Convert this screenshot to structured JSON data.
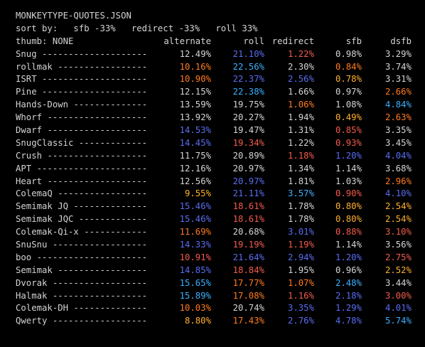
{
  "title": "MONKEYTYPE-QUOTES.JSON",
  "sort_line": "sort by:   sfb -33%   redirect -33%   roll 33%",
  "header": {
    "thumb": "thumb: NONE",
    "columns": [
      "alternate",
      "roll",
      "redirect",
      "sfb",
      "dsfb"
    ]
  },
  "colors": {
    "default": "#d4d4d4",
    "orange": "#ff7a1f",
    "red": "#f25b4d",
    "blue": "#5a6cf0",
    "cyan": "#3ab0ff",
    "gold": "#ffb02e"
  },
  "rows": [
    {
      "name": "Snug",
      "dashes": "--------------------",
      "cells": [
        {
          "v": "12.49%",
          "c": "default"
        },
        {
          "v": "21.10%",
          "c": "blue"
        },
        {
          "v": "1.22%",
          "c": "red"
        },
        {
          "v": "0.98%",
          "c": "default"
        },
        {
          "v": "3.29%",
          "c": "default"
        }
      ]
    },
    {
      "name": "rollmak",
      "dashes": "-----------------",
      "cells": [
        {
          "v": "10.16%",
          "c": "orange"
        },
        {
          "v": "22.56%",
          "c": "cyan"
        },
        {
          "v": "2.30%",
          "c": "default"
        },
        {
          "v": "0.84%",
          "c": "orange"
        },
        {
          "v": "3.74%",
          "c": "default"
        }
      ]
    },
    {
      "name": "ISRT",
      "dashes": "--------------------",
      "cells": [
        {
          "v": "10.90%",
          "c": "orange"
        },
        {
          "v": "22.37%",
          "c": "blue"
        },
        {
          "v": "2.56%",
          "c": "blue"
        },
        {
          "v": "0.78%",
          "c": "gold"
        },
        {
          "v": "3.31%",
          "c": "default"
        }
      ]
    },
    {
      "name": "Pine",
      "dashes": "--------------------",
      "cells": [
        {
          "v": "12.15%",
          "c": "default"
        },
        {
          "v": "22.38%",
          "c": "cyan"
        },
        {
          "v": "1.66%",
          "c": "default"
        },
        {
          "v": "0.97%",
          "c": "default"
        },
        {
          "v": "2.66%",
          "c": "orange"
        }
      ]
    },
    {
      "name": "Hands-Down",
      "dashes": "--------------",
      "cells": [
        {
          "v": "13.59%",
          "c": "default"
        },
        {
          "v": "19.75%",
          "c": "default"
        },
        {
          "v": "1.06%",
          "c": "orange"
        },
        {
          "v": "1.08%",
          "c": "default"
        },
        {
          "v": "4.84%",
          "c": "cyan"
        }
      ]
    },
    {
      "name": "Whorf",
      "dashes": "-------------------",
      "cells": [
        {
          "v": "13.92%",
          "c": "default"
        },
        {
          "v": "20.27%",
          "c": "default"
        },
        {
          "v": "1.94%",
          "c": "default"
        },
        {
          "v": "0.49%",
          "c": "gold"
        },
        {
          "v": "2.63%",
          "c": "orange"
        }
      ]
    },
    {
      "name": "Dwarf",
      "dashes": "-------------------",
      "cells": [
        {
          "v": "14.53%",
          "c": "blue"
        },
        {
          "v": "19.47%",
          "c": "default"
        },
        {
          "v": "1.31%",
          "c": "default"
        },
        {
          "v": "0.85%",
          "c": "red"
        },
        {
          "v": "3.35%",
          "c": "default"
        }
      ]
    },
    {
      "name": "SnugClassic",
      "dashes": "-------------",
      "cells": [
        {
          "v": "14.45%",
          "c": "blue"
        },
        {
          "v": "19.34%",
          "c": "red"
        },
        {
          "v": "1.22%",
          "c": "default"
        },
        {
          "v": "0.93%",
          "c": "red"
        },
        {
          "v": "3.45%",
          "c": "default"
        }
      ]
    },
    {
      "name": "Crush",
      "dashes": "-------------------",
      "cells": [
        {
          "v": "11.75%",
          "c": "default"
        },
        {
          "v": "20.89%",
          "c": "default"
        },
        {
          "v": "1.18%",
          "c": "red"
        },
        {
          "v": "1.20%",
          "c": "blue"
        },
        {
          "v": "4.04%",
          "c": "blue"
        }
      ]
    },
    {
      "name": "APT",
      "dashes": "---------------------",
      "cells": [
        {
          "v": "12.16%",
          "c": "default"
        },
        {
          "v": "20.97%",
          "c": "default"
        },
        {
          "v": "1.34%",
          "c": "default"
        },
        {
          "v": "1.14%",
          "c": "default"
        },
        {
          "v": "3.68%",
          "c": "default"
        }
      ]
    },
    {
      "name": "Heart",
      "dashes": "-------------------",
      "cells": [
        {
          "v": "12.56%",
          "c": "default"
        },
        {
          "v": "20.97%",
          "c": "blue"
        },
        {
          "v": "1.81%",
          "c": "default"
        },
        {
          "v": "1.03%",
          "c": "default"
        },
        {
          "v": "2.96%",
          "c": "orange"
        }
      ]
    },
    {
      "name": "ColemaQ",
      "dashes": "-----------------",
      "cells": [
        {
          "v": "9.55%",
          "c": "gold"
        },
        {
          "v": "21.11%",
          "c": "blue"
        },
        {
          "v": "3.57%",
          "c": "cyan"
        },
        {
          "v": "0.90%",
          "c": "red"
        },
        {
          "v": "4.10%",
          "c": "blue"
        }
      ]
    },
    {
      "name": "Semimak JQ",
      "dashes": "--------------",
      "cells": [
        {
          "v": "15.46%",
          "c": "blue"
        },
        {
          "v": "18.61%",
          "c": "red"
        },
        {
          "v": "1.78%",
          "c": "default"
        },
        {
          "v": "0.80%",
          "c": "gold"
        },
        {
          "v": "2.54%",
          "c": "gold"
        }
      ]
    },
    {
      "name": "Semimak JQC",
      "dashes": "-------------",
      "cells": [
        {
          "v": "15.46%",
          "c": "blue"
        },
        {
          "v": "18.61%",
          "c": "red"
        },
        {
          "v": "1.78%",
          "c": "default"
        },
        {
          "v": "0.80%",
          "c": "gold"
        },
        {
          "v": "2.54%",
          "c": "gold"
        }
      ]
    },
    {
      "name": "Colemak-Qi-x",
      "dashes": "------------",
      "cells": [
        {
          "v": "11.69%",
          "c": "orange"
        },
        {
          "v": "20.68%",
          "c": "default"
        },
        {
          "v": "3.01%",
          "c": "blue"
        },
        {
          "v": "0.88%",
          "c": "red"
        },
        {
          "v": "3.10%",
          "c": "red"
        }
      ]
    },
    {
      "name": "SnuSnu",
      "dashes": "------------------",
      "cells": [
        {
          "v": "14.33%",
          "c": "blue"
        },
        {
          "v": "19.19%",
          "c": "red"
        },
        {
          "v": "1.19%",
          "c": "red"
        },
        {
          "v": "1.14%",
          "c": "default"
        },
        {
          "v": "3.56%",
          "c": "default"
        }
      ]
    },
    {
      "name": "boo",
      "dashes": "---------------------",
      "cells": [
        {
          "v": "10.91%",
          "c": "red"
        },
        {
          "v": "21.64%",
          "c": "blue"
        },
        {
          "v": "2.94%",
          "c": "blue"
        },
        {
          "v": "1.20%",
          "c": "blue"
        },
        {
          "v": "2.75%",
          "c": "red"
        }
      ]
    },
    {
      "name": "Semimak",
      "dashes": "-----------------",
      "cells": [
        {
          "v": "14.85%",
          "c": "blue"
        },
        {
          "v": "18.84%",
          "c": "red"
        },
        {
          "v": "1.95%",
          "c": "default"
        },
        {
          "v": "0.96%",
          "c": "default"
        },
        {
          "v": "2.52%",
          "c": "gold"
        }
      ]
    },
    {
      "name": "Dvorak",
      "dashes": "------------------",
      "cells": [
        {
          "v": "15.65%",
          "c": "cyan"
        },
        {
          "v": "17.77%",
          "c": "orange"
        },
        {
          "v": "1.07%",
          "c": "orange"
        },
        {
          "v": "2.48%",
          "c": "cyan"
        },
        {
          "v": "3.44%",
          "c": "default"
        }
      ]
    },
    {
      "name": "Halmak",
      "dashes": "------------------",
      "cells": [
        {
          "v": "15.89%",
          "c": "cyan"
        },
        {
          "v": "17.08%",
          "c": "orange"
        },
        {
          "v": "1.16%",
          "c": "red"
        },
        {
          "v": "2.18%",
          "c": "blue"
        },
        {
          "v": "3.00%",
          "c": "red"
        }
      ]
    },
    {
      "name": "Colemak-DH",
      "dashes": "--------------",
      "cells": [
        {
          "v": "10.03%",
          "c": "orange"
        },
        {
          "v": "20.74%",
          "c": "default"
        },
        {
          "v": "3.35%",
          "c": "blue"
        },
        {
          "v": "1.29%",
          "c": "blue"
        },
        {
          "v": "4.01%",
          "c": "blue"
        }
      ]
    },
    {
      "name": "Qwerty",
      "dashes": "------------------",
      "cells": [
        {
          "v": "8.80%",
          "c": "gold"
        },
        {
          "v": "17.43%",
          "c": "orange"
        },
        {
          "v": "2.76%",
          "c": "blue"
        },
        {
          "v": "4.78%",
          "c": "blue"
        },
        {
          "v": "5.74%",
          "c": "cyan"
        }
      ]
    }
  ]
}
